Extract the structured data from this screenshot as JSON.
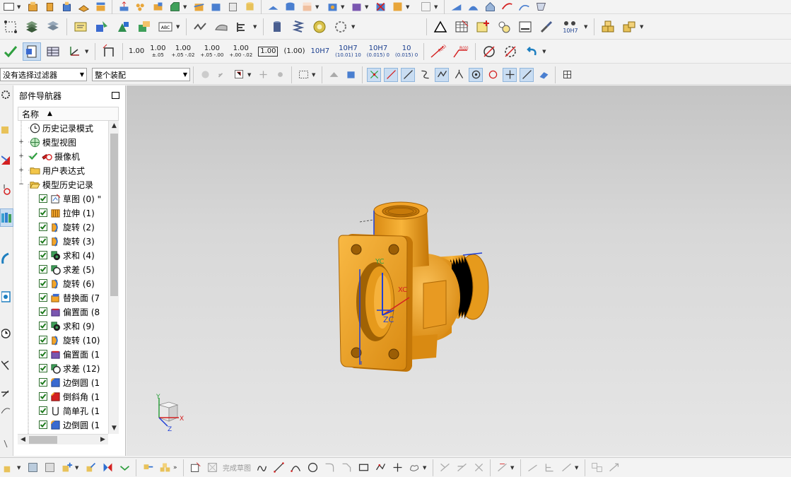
{
  "toolbar": {
    "dimensions": [
      {
        "main": "1.00",
        "sub": ""
      },
      {
        "main": "1.00",
        "sub": "±.05"
      },
      {
        "main": "1.00",
        "sub": "+.05 -.02"
      },
      {
        "main": "1.00",
        "sub": "+.05 -.00"
      },
      {
        "main": "1.00",
        "sub": "+.00 -.02"
      },
      {
        "main": "1.00",
        "sub": ""
      },
      {
        "main": "(1.00)",
        "sub": ""
      },
      {
        "main": "10H7",
        "sub": ""
      },
      {
        "main": "10H7",
        "sub": "(10.01) 10"
      },
      {
        "main": "10H7",
        "sub": "(0.015) 0"
      },
      {
        "main": "10",
        "sub": "(0.015) 0"
      }
    ],
    "fit_label": "10H7",
    "abc_label": "ABC",
    "r_labels": [
      "R(0)",
      "R(0)"
    ]
  },
  "filter": {
    "type_filter": "没有选择过滤器",
    "scope": "整个装配"
  },
  "navigator": {
    "title": "部件导航器",
    "column_name": "名称",
    "items": [
      {
        "label": "历史记录模式",
        "icon": "clock-icon",
        "expander": "",
        "checked": false
      },
      {
        "label": "模型视图",
        "icon": "model-views-icon",
        "expander": "+",
        "checked": false
      },
      {
        "label": "摄像机",
        "icon": "camera-icon",
        "expander": "+",
        "checked": false
      },
      {
        "label": "用户表达式",
        "icon": "folder-icon",
        "expander": "+",
        "checked": false
      },
      {
        "label": "模型历史记录",
        "icon": "folder-open-icon",
        "expander": "−",
        "checked": false
      },
      {
        "label": "草图 (0) \"",
        "icon": "sketch-icon",
        "checked": true
      },
      {
        "label": "拉伸 (1)",
        "icon": "extrude-icon",
        "checked": true
      },
      {
        "label": "旋转 (2)",
        "icon": "revolve-icon",
        "checked": true
      },
      {
        "label": "旋转 (3)",
        "icon": "revolve-icon",
        "checked": true
      },
      {
        "label": "求和 (4)",
        "icon": "unite-icon",
        "checked": true
      },
      {
        "label": "求差 (5)",
        "icon": "subtract-icon",
        "checked": true
      },
      {
        "label": "旋转 (6)",
        "icon": "revolve-icon",
        "checked": true
      },
      {
        "label": "替换面 (7",
        "icon": "replace-face-icon",
        "checked": true
      },
      {
        "label": "偏置面 (8",
        "icon": "offset-face-icon",
        "checked": true
      },
      {
        "label": "求和 (9)",
        "icon": "unite-icon",
        "checked": true
      },
      {
        "label": "旋转 (10)",
        "icon": "revolve-icon",
        "checked": true
      },
      {
        "label": "偏置面 (1",
        "icon": "offset-face-icon",
        "checked": true
      },
      {
        "label": "求差 (12)",
        "icon": "subtract-icon",
        "checked": true
      },
      {
        "label": "边倒圆 (1",
        "icon": "edge-blend-icon",
        "checked": true
      },
      {
        "label": "倒斜角 (1",
        "icon": "chamfer-icon",
        "checked": true
      },
      {
        "label": "简单孔 (1",
        "icon": "hole-icon",
        "checked": true
      },
      {
        "label": "边倒圆 (1",
        "icon": "edge-blend-icon",
        "checked": true
      }
    ]
  },
  "viewport": {
    "csys_labels": {
      "x": "X",
      "y": "Y",
      "z": "Z"
    },
    "datum_labels": [
      "YC",
      "XC",
      "ZC"
    ]
  },
  "bottom_toolbar": {
    "finish_sketch": "完成草图"
  },
  "colors": {
    "part_orange": "#f5a623",
    "part_shadow": "#b8740e",
    "selection_blue": "#1f3fd6",
    "highlight_red": "#d42020"
  }
}
